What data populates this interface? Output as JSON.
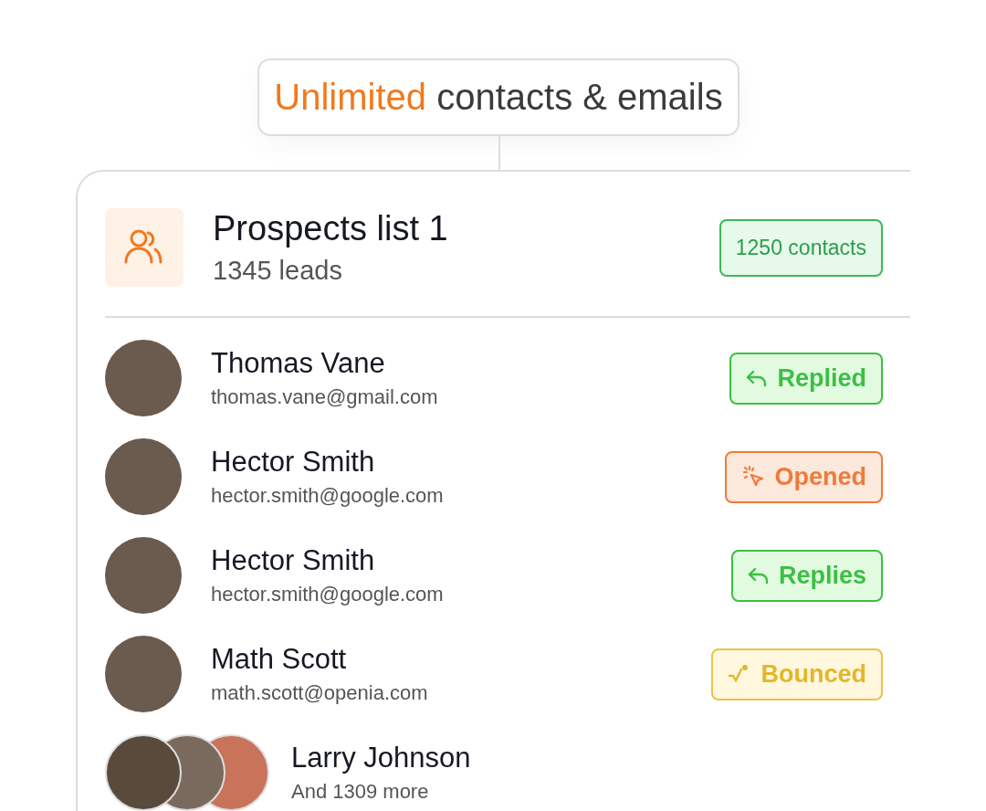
{
  "headline": {
    "accent": "Unlimited",
    "rest": "contacts & emails"
  },
  "list": {
    "title": "Prospects list 1",
    "subtitle": "1345 leads",
    "count_badge": "1250 contacts"
  },
  "contacts": [
    {
      "name": "Thomas Vane",
      "email": "thomas.vane@gmail.com",
      "status": {
        "kind": "replied",
        "label": "Replied"
      }
    },
    {
      "name": "Hector Smith",
      "email": "hector.smith@google.com",
      "status": {
        "kind": "opened",
        "label": "Opened"
      }
    },
    {
      "name": "Hector Smith",
      "email": "hector.smith@google.com",
      "status": {
        "kind": "replied",
        "label": "Replies"
      }
    },
    {
      "name": "Math Scott",
      "email": "math.scott@openia.com",
      "status": {
        "kind": "bounced",
        "label": "Bounced"
      }
    }
  ],
  "more": {
    "name": "Larry Johnson",
    "caption": "And 1309 more"
  }
}
